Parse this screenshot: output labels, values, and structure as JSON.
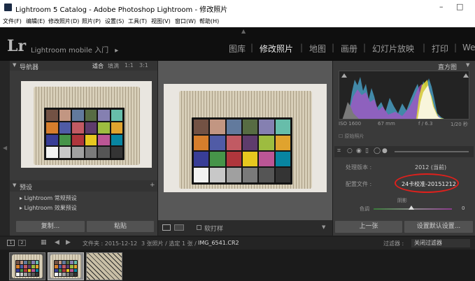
{
  "window": {
    "title": "Lightroom 5 Catalog - Adobe Photoshop Lightroom - 修改照片",
    "minimize": "–",
    "maximize": "□"
  },
  "menu": [
    "文件(F)",
    "编辑(E)",
    "修改照片(D)",
    "照片(P)",
    "设置(S)",
    "工具(T)",
    "视图(V)",
    "窗口(W)",
    "帮助(H)"
  ],
  "module_bar": {
    "logo": "Lr",
    "mobile_label": "Lightroom mobile 入门",
    "mobile_arrow": "▸",
    "modules": [
      "图库",
      "修改照片",
      "地图",
      "画册",
      "幻灯片放映",
      "打印",
      "We"
    ],
    "active_module": "修改照片"
  },
  "navigator": {
    "title": "导航器",
    "zoom_options": [
      "适合",
      "填满",
      "1:1",
      "3:1"
    ]
  },
  "presets": {
    "title": "预设",
    "items": [
      "Lightroom 常规预设",
      "Lightroom 效果预设"
    ]
  },
  "left_buttons": {
    "copy": "复制...",
    "paste": "粘贴"
  },
  "histogram": {
    "title": "直方图",
    "iso": "ISO 1600",
    "focal": "67 mm",
    "aperture": "f / 6.3",
    "shutter": "1/20 秒",
    "original_photo": "原始照片"
  },
  "camera_calibration": {
    "process_label": "处理版本 :",
    "process_value": "2012 (当前)",
    "profile_label": "配置文件 :",
    "profile_value": "24卡校准-20151212",
    "shadows_label": "阴影",
    "tint_label": "色调",
    "tint_value": "0"
  },
  "right_buttons": {
    "previous": "上一张",
    "reset": "设置默认设置..."
  },
  "toolbar": {
    "soft_proof": "软打样"
  },
  "filmstrip_bar": {
    "page1": "1",
    "page2": "2",
    "source": "文件夹 : 2015-12-12",
    "count": "3 张照片 / 选定 1 张 /",
    "filename": "IMG_6541.CR2",
    "filter_label": "过滤器 :",
    "filter_value": "关闭过滤器"
  },
  "colors": {
    "module_bar_bg": "#0f0f0f",
    "panel_bg": "#3a3a3a",
    "center_bg": "#585858",
    "highlight_circle": "#e0201c"
  },
  "checker_colors": [
    "#735244",
    "#c29682",
    "#627a9d",
    "#576c43",
    "#8580b1",
    "#67bdaa",
    "#d67e2c",
    "#505ba6",
    "#c15a63",
    "#5e3c6c",
    "#9dbc40",
    "#e0a32e",
    "#383d96",
    "#469449",
    "#af363c",
    "#e7c71f",
    "#bb5695",
    "#0885a1",
    "#f3f3f2",
    "#c8c8c8",
    "#a0a0a0",
    "#7a7a7a",
    "#555555",
    "#343434"
  ],
  "icons": [
    "window-logo-icon",
    "minimize-icon",
    "maximize-icon",
    "collapse-arrow-icon",
    "panel-toggle-icon",
    "histogram-toggle-icon",
    "crop-icon",
    "spot-removal-icon",
    "redeye-icon",
    "graduated-filter-icon",
    "radial-filter-icon",
    "brush-icon"
  ]
}
